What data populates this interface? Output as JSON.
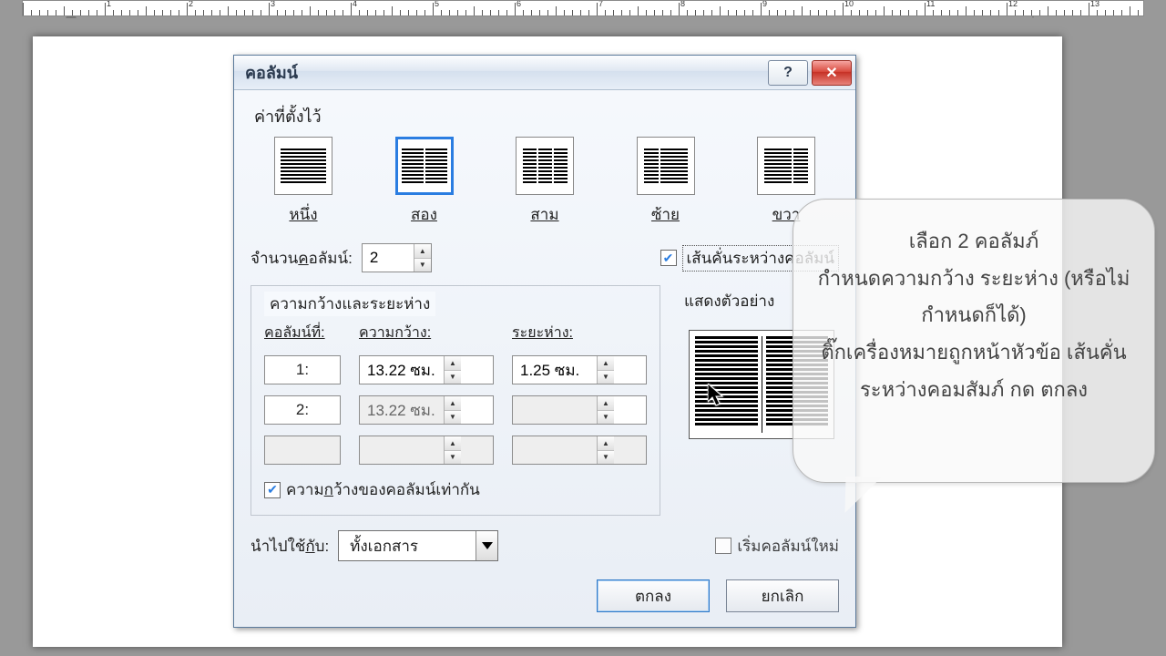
{
  "ruler": {
    "unit": "cm",
    "min": 1,
    "max": 17
  },
  "dialog": {
    "title": "คอลัมน์",
    "presets_label": "ค่าที่ตั้งไว้",
    "presets": {
      "one": "หนึ่ง",
      "two": "สอง",
      "three": "สาม",
      "left": "ซ้าย",
      "right": "ขวา",
      "selected": "two"
    },
    "num_columns": {
      "label": "จำนวนคอลัมน์:",
      "value": "2"
    },
    "line_between": {
      "label": "เส้นคั่นระหว่างคอลัมน์",
      "checked": true
    },
    "width_group": {
      "label": "ความกว้างและระยะห่าง",
      "headers": {
        "colnum": "คอลัมน์ที่:",
        "width": "ความกว้าง:",
        "spacing": "ระยะห่าง:"
      },
      "rows": [
        {
          "idx": "1:",
          "width": "13.22 ซม.",
          "spacing": "1.25 ซม."
        },
        {
          "idx": "2:",
          "width": "13.22 ซม.",
          "spacing": ""
        },
        {
          "idx": "",
          "width": "",
          "spacing": ""
        }
      ],
      "equal": {
        "label": "ความกว้างของคอลัมน์เท่ากัน",
        "checked": true
      }
    },
    "preview_label": "แสดงตัวอย่าง",
    "apply": {
      "label": "นำไปใช้กับ:",
      "value": "ทั้งเอกสาร"
    },
    "start_new": {
      "label": "เริ่มคอลัมน์ใหม่",
      "checked": false
    },
    "buttons": {
      "ok": "ตกลง",
      "cancel": "ยกเลิก"
    }
  },
  "callout": {
    "l1": "เลือก 2 คอลัมภ์",
    "l2": "กำหนดความกว้าง ระยะห่าง (หรือไม่กำหนดก็ได้)",
    "l3": "ติ๊กเครื่องหมายถูกหน้าหัวข้อ  เส้นคั่นระหว่างคอมสัมภ์ กด ตกลง"
  }
}
